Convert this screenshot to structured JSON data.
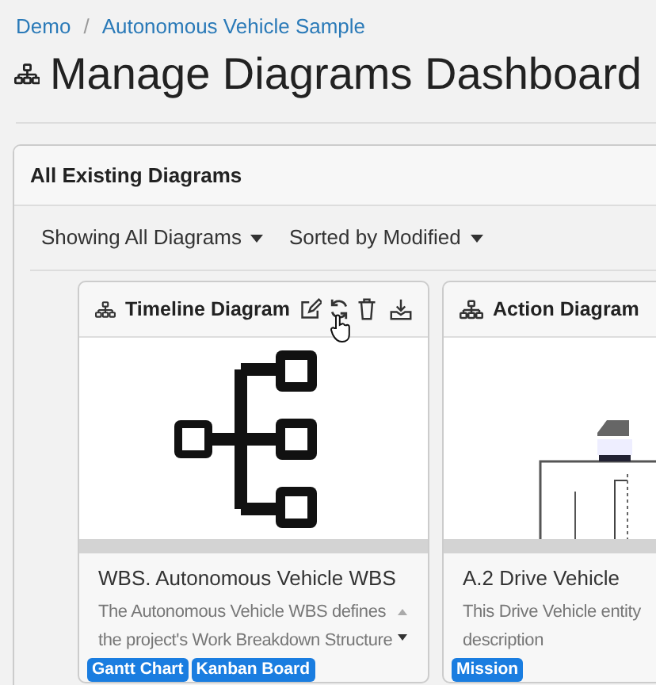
{
  "breadcrumb": [
    "Demo",
    "/",
    "Autonomous Vehicle Sample"
  ],
  "page_title": "Manage Diagrams Dashboard",
  "panel": {
    "title": "All Existing Diagrams",
    "filters": [
      {
        "label": "Showing All Diagrams"
      },
      {
        "label": "Sorted by Modified"
      }
    ],
    "cards": [
      {
        "kind": "hierarchy",
        "header": "Timeline Diagram",
        "actions": true,
        "title": "WBS. Autonomous Vehicle WBS",
        "description_lines": [
          "The Autonomous Vehicle WBS defines",
          "the project's Work Breakdown Structure"
        ],
        "scroll_arrows": true,
        "tags": [
          "Gantt Chart",
          "Kanban Board"
        ]
      },
      {
        "kind": "picture",
        "header": "Action Diagram",
        "actions": false,
        "title": "A.2 Drive Vehicle",
        "description_lines": [
          "This Drive Vehicle entity",
          "description"
        ],
        "scroll_arrows": false,
        "tags": [
          "Mission"
        ]
      }
    ]
  }
}
